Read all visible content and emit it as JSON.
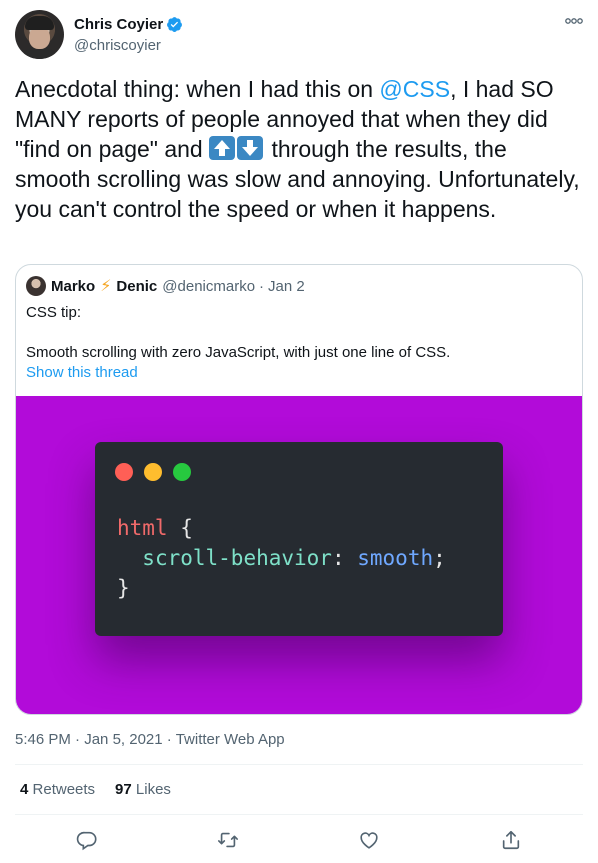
{
  "author": {
    "display_name": "Chris Coyier",
    "handle": "@chriscoyier",
    "verified": true
  },
  "tweet": {
    "text_before_mention": "Anecdotal thing: when I had this on ",
    "mention": "@CSS",
    "text_after_mention": ", I had SO MANY reports of people annoyed that when they did \"find on page\" and ",
    "emoji": [
      "up-arrow-emoji",
      "down-arrow-emoji"
    ],
    "text_after_emoji": " through the results, the smooth scrolling was slow and annoying. Unfortunately, you can't control the speed or when it happens."
  },
  "quote": {
    "name_first": "Marko",
    "name_emoji": "⚡",
    "name_last": "Denic",
    "handle": "@denicmarko",
    "separator": "·",
    "date": "Jan 2",
    "line1": "CSS tip:",
    "line2": "Smooth scrolling with zero JavaScript, with just one line of CSS.",
    "show_thread": "Show this thread",
    "media": {
      "background_color": "#b20bd9",
      "code_selector": "html",
      "code_open": " {",
      "code_property": "scroll-behavior",
      "code_colon": ": ",
      "code_value": "smooth",
      "code_semicolon": ";",
      "code_close": "}"
    }
  },
  "meta": {
    "time": "5:46 PM",
    "sep1": " · ",
    "date": "Jan 5, 2021",
    "sep2": " · ",
    "source": "Twitter Web App"
  },
  "stats": {
    "retweets_count": "4",
    "retweets_label": "Retweets",
    "likes_count": "97",
    "likes_label": "Likes"
  },
  "actions": [
    "reply-icon",
    "retweet-icon",
    "like-icon",
    "share-icon"
  ],
  "colors": {
    "accent": "#1d9bf0",
    "text": "#0f1419",
    "secondary": "#536471"
  }
}
